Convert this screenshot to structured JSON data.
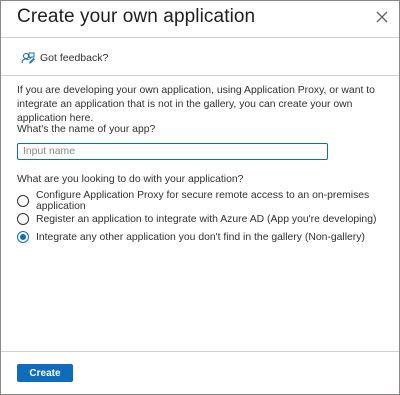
{
  "dialog": {
    "title": "Create your own application",
    "feedback_label": "Got feedback?",
    "description": "If you are developing your own application, using Application Proxy, or want to integrate an application that is not in the gallery, you can create your own application here.",
    "name_label": "What's the name of your app?",
    "name_input": {
      "value": "",
      "placeholder": "Input name"
    },
    "question": "What are you looking to do with your application?",
    "options": [
      {
        "label": "Configure Application Proxy for secure remote access to an on-premises application",
        "checked": false
      },
      {
        "label": "Register an application to integrate with Azure AD (App you're developing)",
        "checked": false
      },
      {
        "label": "Integrate any other application you don't find in the gallery (Non-gallery)",
        "checked": true
      }
    ],
    "create_label": "Create"
  },
  "icons": {
    "close": "close-icon",
    "feedback": "feedback-person-icon"
  },
  "colors": {
    "accent": "#0f6cbd",
    "border": "#8a8886",
    "text": "#323130"
  }
}
